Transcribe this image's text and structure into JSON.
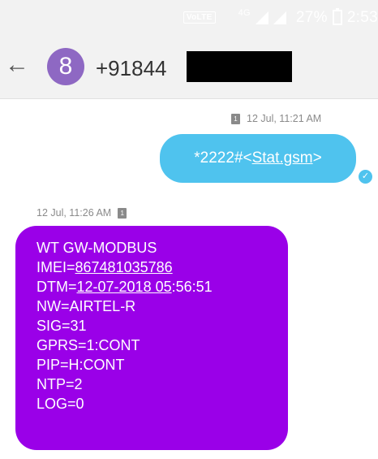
{
  "status_bar": {
    "volte": "VoLTE",
    "network": "4G",
    "battery": "27%",
    "time": "2:53"
  },
  "header": {
    "avatar_letter": "8",
    "contact_number": "+91844"
  },
  "messages": {
    "outgoing": {
      "timestamp": "12 Jul, 11:21 AM",
      "sim": "1",
      "text_prefix": "*2222#<",
      "link_text": "Stat.gsm",
      "text_suffix": ">"
    },
    "incoming": {
      "timestamp": "12 Jul, 11:26 AM",
      "sim": "1",
      "lines": {
        "l1": "WT GW-MODBUS",
        "l2_prefix": "IMEI=",
        "l2_link": "867481035786",
        "l3_prefix": "DTM=",
        "l3_link": "12-07-2018 05",
        "l3_suffix": ":56:51",
        "l4": "NW=AIRTEL-R",
        "l5": "SIG=31",
        "l6": "GPRS=1:CONT",
        "l7": "PIP=H:CONT",
        "l8": "NTP=2",
        "l9": "LOG=0"
      }
    }
  },
  "colors": {
    "outgoing_bubble": "#4fc3ee",
    "incoming_bubble": "#9a00e8",
    "avatar": "#8e68c3"
  }
}
